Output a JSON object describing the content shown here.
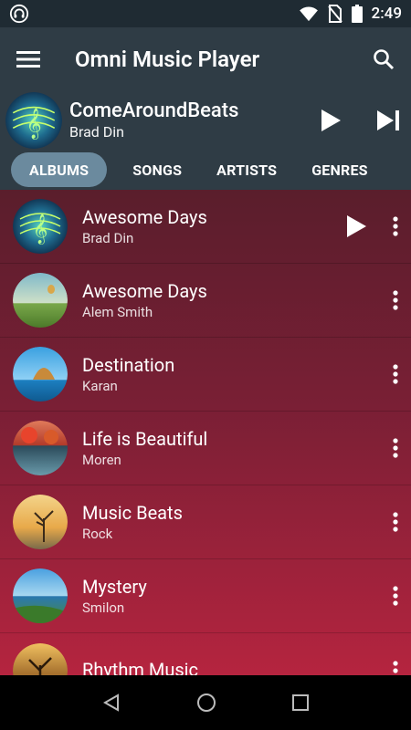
{
  "status_bar": {
    "time": "2:49",
    "icons": [
      "headphones-icon",
      "wifi-icon",
      "no-sim-icon",
      "battery-icon"
    ]
  },
  "app_bar": {
    "title": "Omni Music Player",
    "menu_icon": "menu-icon",
    "search_icon": "search-icon"
  },
  "now_playing": {
    "title": "ComeAroundBeats",
    "artist": "Brad Din",
    "play_icon": "play-icon",
    "next_icon": "skip-next-icon"
  },
  "tabs": [
    {
      "label": "ALBUMS",
      "active": true
    },
    {
      "label": "SONGS",
      "active": false
    },
    {
      "label": "ARTISTS",
      "active": false
    },
    {
      "label": "GENRES",
      "active": false
    }
  ],
  "albums": [
    {
      "title": "Awesome Days",
      "artist": "Brad Din",
      "playing": true
    },
    {
      "title": "Awesome Days",
      "artist": "Alem Smith",
      "playing": false
    },
    {
      "title": "Destination",
      "artist": "Karan",
      "playing": false
    },
    {
      "title": "Life is Beautiful",
      "artist": "Moren",
      "playing": false
    },
    {
      "title": "Music Beats",
      "artist": "Rock",
      "playing": false
    },
    {
      "title": "Mystery",
      "artist": "Smilon",
      "playing": false
    },
    {
      "title": "Rhythm Music",
      "artist": "",
      "playing": false
    }
  ],
  "nav_bar": {
    "icons": [
      "back-icon",
      "home-icon",
      "recents-icon"
    ]
  },
  "colors": {
    "toolbar": "#2f3c45",
    "active_tab": "#6b8a9e",
    "list_gradient_top": "#5a1e2c",
    "list_gradient_bottom": "#b5243f"
  }
}
